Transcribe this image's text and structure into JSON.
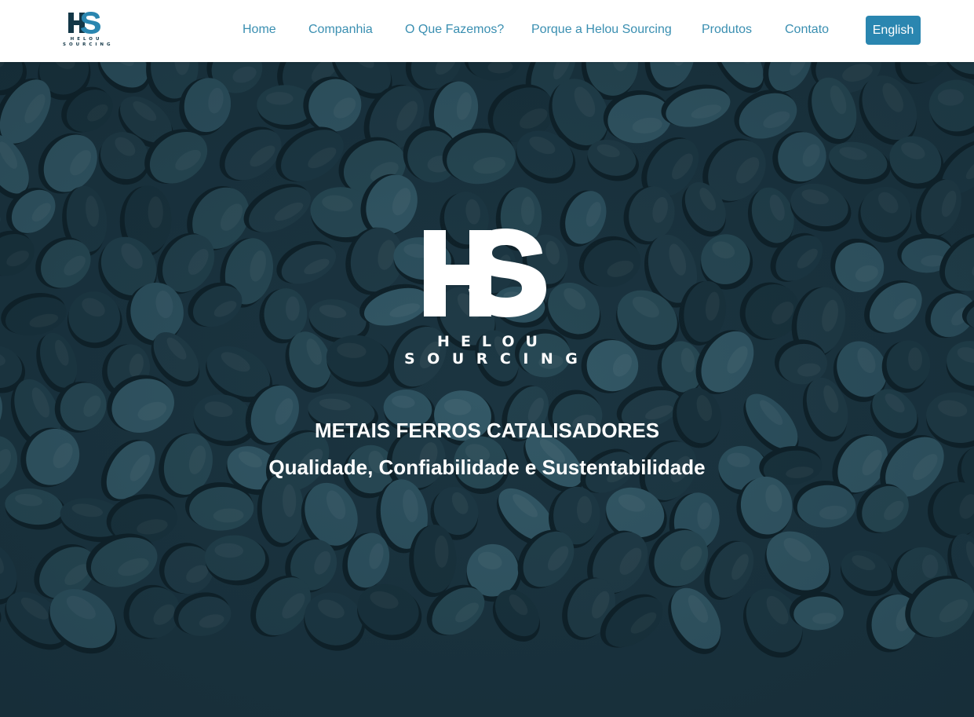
{
  "brand": {
    "mark": "HS",
    "name_line1": "HELOU",
    "name_line2": "SOURCING",
    "primary_color": "#133747",
    "accent_color": "#2a86b0"
  },
  "nav": {
    "items": [
      {
        "label": "Home"
      },
      {
        "label": "Companhia"
      },
      {
        "label": "O Que Fazemos?"
      },
      {
        "label": "Porque a Helou Sourcing"
      },
      {
        "label": "Produtos"
      },
      {
        "label": "Contato"
      }
    ],
    "language_button": "English",
    "link_color": "#3a8fb1"
  },
  "hero": {
    "background": "dark teal stone pebbles",
    "tagline": "METAIS FERROS CATALISADORES",
    "subtitle": "Qualidade, Confiabilidade e Sustentabilidade"
  }
}
